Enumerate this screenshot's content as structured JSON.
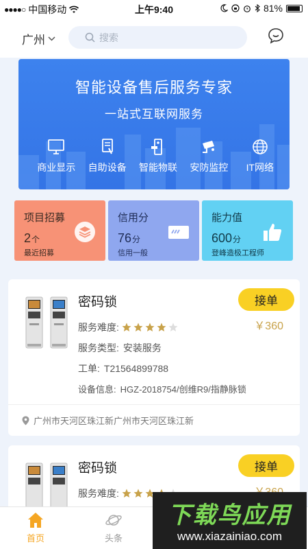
{
  "status_bar": {
    "signal": "●●●●○",
    "carrier": "中国移动",
    "time": "上午9:40",
    "battery": "81%"
  },
  "header": {
    "city": "广州",
    "search_placeholder": "搜索"
  },
  "banner": {
    "title": "智能设备售后服务专家",
    "subtitle": "一站式互联网服务",
    "items": [
      {
        "label": "商业显示",
        "icon": "monitor-icon"
      },
      {
        "label": "自助设备",
        "icon": "kiosk-icon"
      },
      {
        "label": "智能物联",
        "icon": "smart-lock-icon"
      },
      {
        "label": "安防监控",
        "icon": "camera-icon"
      },
      {
        "label": "IT网络",
        "icon": "globe-icon"
      }
    ]
  },
  "stats": [
    {
      "title": "项目招募",
      "value": "2",
      "unit": "个",
      "desc": "最近招募",
      "icon": "layers-icon",
      "color": "#f79276"
    },
    {
      "title": "信用分",
      "value": "76",
      "unit": "分",
      "desc": "信用一般",
      "icon": "card-icon",
      "color": "#8fa7ef"
    },
    {
      "title": "能力值",
      "value": "600",
      "unit": "分",
      "desc": "登峰造极工程师",
      "icon": "thumbs-up-icon",
      "color": "#62d1f3"
    }
  ],
  "orders": [
    {
      "name": "密码锁",
      "difficulty_label": "服务难度:",
      "rating": 4,
      "rating_max": 5,
      "type_label": "服务类型:",
      "type_value": "安装服务",
      "ticket_label": "工单:",
      "ticket_value": "T21564899788",
      "device_label": "设备信息:",
      "device_value": "HGZ-2018754/创维R9/指静脉锁",
      "button": "接单",
      "price": "￥360",
      "address": "广州市天河区珠江新广州市天河区珠江新"
    },
    {
      "name": "密码锁",
      "difficulty_label": "服务难度:",
      "rating": 4,
      "rating_max": 5,
      "button": "接单",
      "price": "￥360"
    }
  ],
  "tabs": [
    {
      "label": "首页",
      "icon": "home-icon",
      "active": true
    },
    {
      "label": "头条",
      "icon": "planet-icon",
      "active": false
    }
  ],
  "watermark": {
    "title": "下载鸟应用",
    "url": "www.xiazainiao.com"
  },
  "colors": {
    "accent": "#f9d024",
    "price": "#c8a24a",
    "banner": "#3d82ee",
    "tab_active": "#f5a623"
  }
}
